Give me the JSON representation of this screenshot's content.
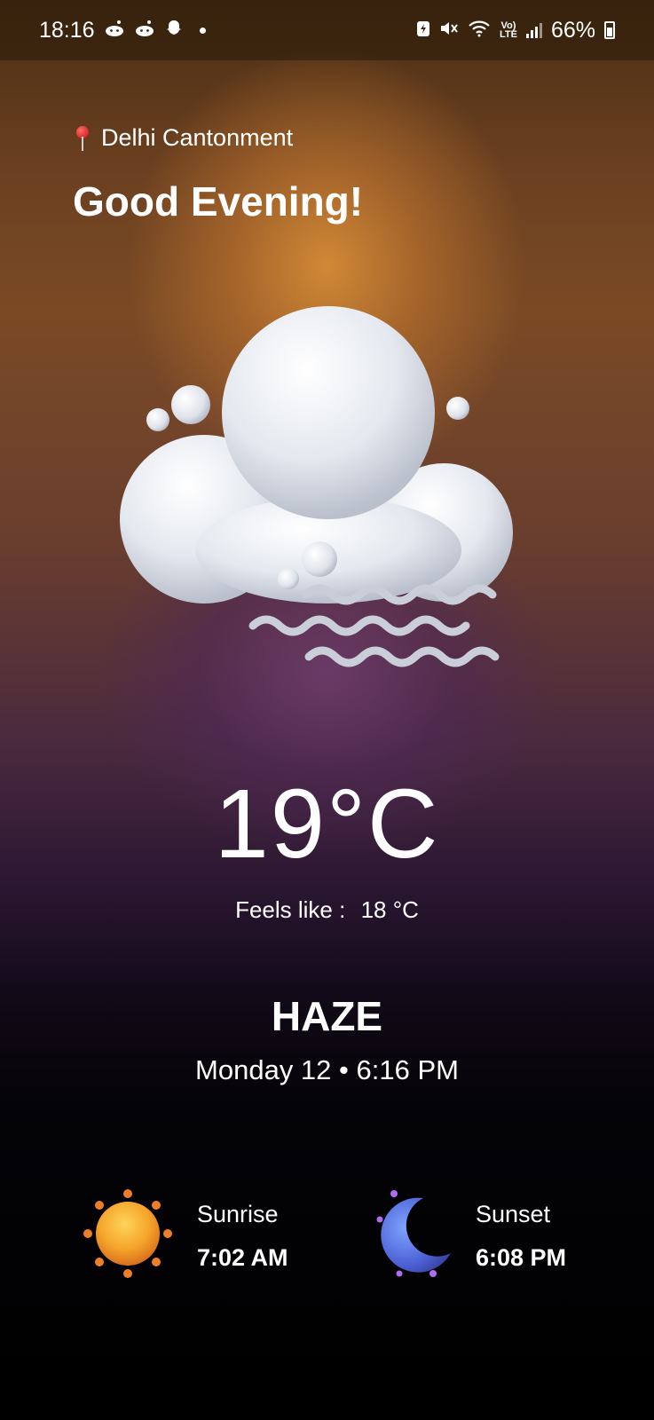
{
  "status_bar": {
    "time": "18:16",
    "battery": "66%",
    "network": "LTE"
  },
  "location": {
    "icon": "pin-icon",
    "name": "Delhi Cantonment"
  },
  "greeting": "Good Evening!",
  "weather": {
    "icon": "haze-cloud-icon",
    "temperature": "19°C",
    "feels_like_label": "Feels like :",
    "feels_like_value": "18 °C",
    "condition": "HAZE",
    "datetime": "Monday 12 • 6:16 PM"
  },
  "sun": {
    "sunrise_label": "Sunrise",
    "sunrise_time": "7:02 AM",
    "sunset_label": "Sunset",
    "sunset_time": "6:08 PM"
  },
  "colors": {
    "accent_orange": "#d68c37",
    "accent_purple": "#6e3c6e",
    "text": "#ffffff",
    "background": "#000000"
  }
}
